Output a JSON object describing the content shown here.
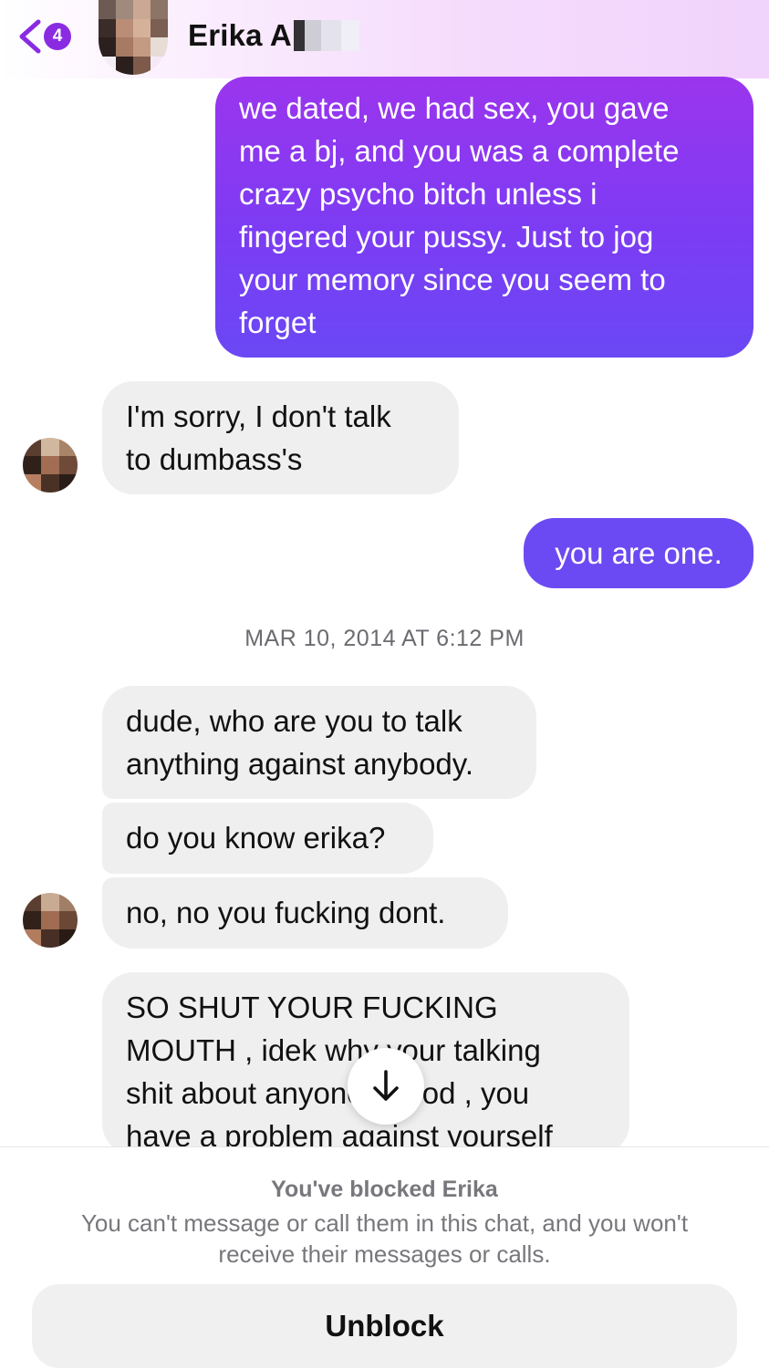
{
  "header": {
    "back_badge_count": "4",
    "contact_name": "Erika A"
  },
  "messages": [
    {
      "direction": "outgoing",
      "text": "we dated, we had sex, you gave\nme a bj, and you was a complete\ncrazy psycho bitch unless i\nfingered your pussy. Just to jog\nyour memory since you seem to\nforget"
    },
    {
      "direction": "incoming",
      "text": "I'm sorry, I don't talk\nto dumbass's"
    },
    {
      "direction": "outgoing",
      "text": "you are one."
    },
    {
      "direction": "incoming",
      "text": "dude, who are you to talk\nanything against anybody."
    },
    {
      "direction": "incoming",
      "text": "do you know erika?"
    },
    {
      "direction": "incoming",
      "text": "no, no you fucking dont."
    },
    {
      "direction": "incoming",
      "text": "SO SHUT YOUR FUCKING\nMOUTH , idek why your talking\nshit about anyone period , you\nhave a problem against yourself"
    }
  ],
  "timestamp": "MAR 10, 2014 AT 6:12 PM",
  "blocked": {
    "title": "You've blocked Erika",
    "description": "You can't message or call them in this chat, and you won't receive their messages or calls.",
    "unblock_label": "Unblock"
  },
  "icons": {
    "back": "chevron-left-icon",
    "scroll": "arrow-down-icon"
  },
  "colors": {
    "accent": "#8a2be2",
    "outgoing_bubble": "#7c3cf3",
    "incoming_bubble": "#efeff0"
  }
}
